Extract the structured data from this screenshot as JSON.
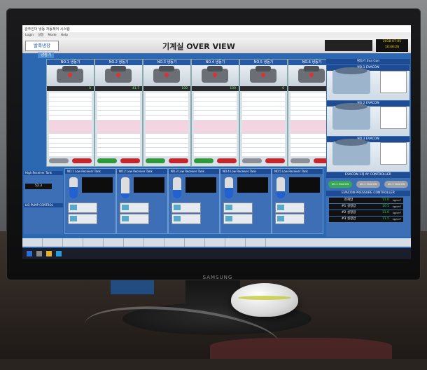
{
  "window": {
    "title": "광주인더 냉동 자동제어 시스템",
    "menu": [
      "Login",
      "설정",
      "Mode",
      "Help"
    ]
  },
  "header": {
    "tab": "발죽냉장",
    "title": "기계실 OVER VIEW",
    "clock_date": "2018-07-05",
    "clock_time": "10:46:26"
  },
  "sections": {
    "compressors": "냉동기",
    "evacon": "냉동기 Eva Con"
  },
  "compressors": [
    {
      "name": "NO.1 냉동기",
      "load": "0"
    },
    {
      "name": "NO.2 냉동기",
      "load": "41.7"
    },
    {
      "name": "NO.3 냉동기",
      "load": "100"
    },
    {
      "name": "NO.4 냉동기",
      "load": "100"
    },
    {
      "name": "NO.5 냉동기",
      "load": "0"
    },
    {
      "name": "NO.6 냉동기",
      "load": "0"
    }
  ],
  "receivers": [
    {
      "title": "High Receiver Tank",
      "level": "52.3"
    },
    {
      "title": "NO.1 Low Receiver Tank"
    },
    {
      "title": "NO.2 Low Receiver Tank"
    },
    {
      "title": "NO.3 Low Receiver Tank"
    },
    {
      "title": "NO.4 Low Receiver Tank"
    },
    {
      "title": "NO.5 Low Receiver Tank"
    }
  ],
  "pump": {
    "title": "LIQ PUMP CONTROL"
  },
  "evacons": [
    "NO.1 EVACON",
    "NO.2 EVACON",
    "NO.3 EVACON"
  ],
  "evacon_control": {
    "title": "EVACON 1개 AY CONTROLLER",
    "buttons": [
      "NO.1 EVACON",
      "NO.2 EVACON",
      "NO.3 EVACON"
    ]
  },
  "pressure": {
    "title": "EVACON PRESSURE CONTROLLER",
    "rows": [
      {
        "label": "현재압",
        "value": "11.0",
        "unit": "kg/cm²"
      },
      {
        "label": "#1 설정압",
        "value": "10.5",
        "unit": "kg/cm²"
      },
      {
        "label": "#2 설정압",
        "value": "11.0",
        "unit": "kg/cm²"
      },
      {
        "label": "#3 설정압",
        "value": "11.5",
        "unit": "kg/cm²"
      }
    ]
  },
  "monitor_brand": "SAMSUNG",
  "colors": {
    "accent": "#2758a8",
    "screen_bg": "#2c68b2",
    "running": "#2e9a3a",
    "stop": "#c8242c"
  }
}
